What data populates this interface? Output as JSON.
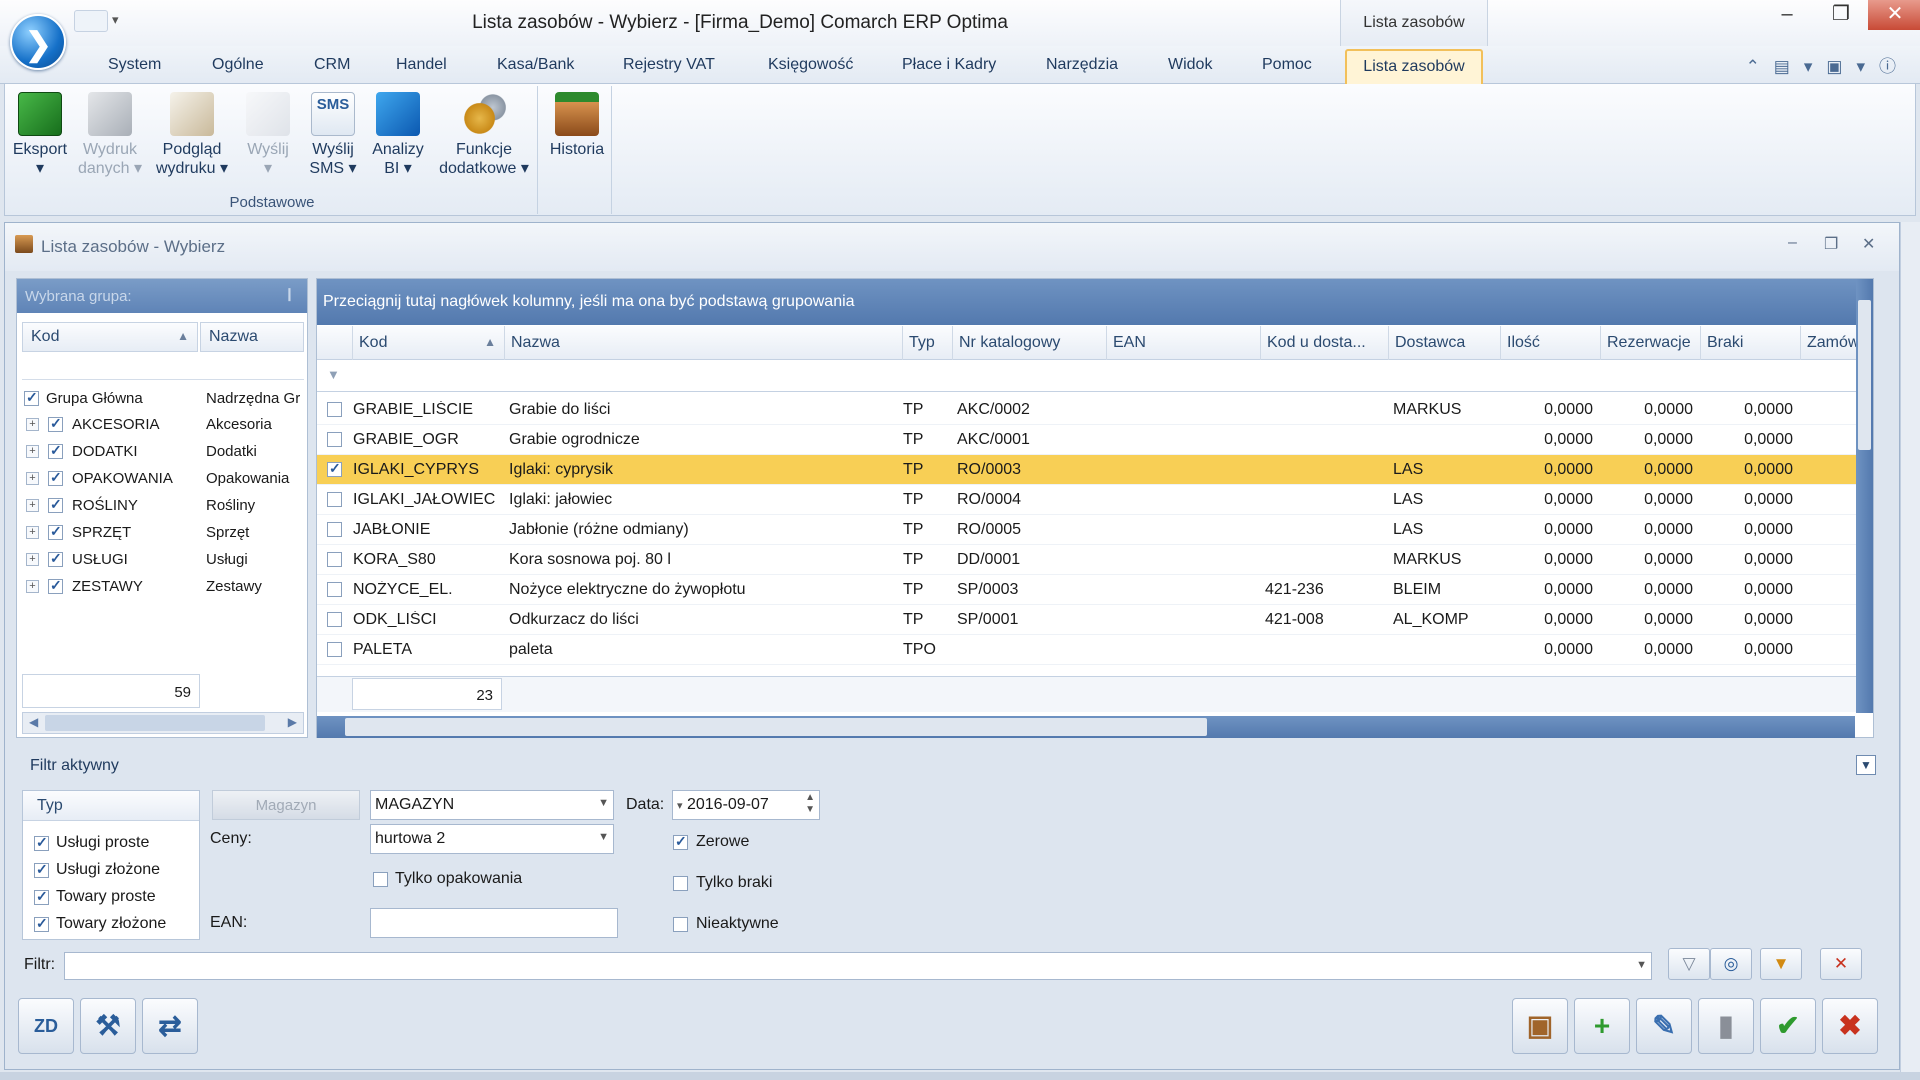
{
  "window": {
    "title": "Lista zasobów - Wybierz - [Firma_Demo] Comarch ERP Optima",
    "context_tab": "Lista zasobów",
    "min": "–",
    "restore": "❐",
    "close": "✕"
  },
  "menu": [
    "System",
    "Ogólne",
    "CRM",
    "Handel",
    "Kasa/Bank",
    "Rejestry VAT",
    "Księgowość",
    "Płace i Kadry",
    "Narzędzia",
    "Widok",
    "Pomoc"
  ],
  "menu_active": "Lista zasobów",
  "ribbon": {
    "buttons": [
      {
        "l1": "Eksport",
        "l2": "▾",
        "icon": "excel-export-icon"
      },
      {
        "l1": "Wydruk",
        "l2": "danych ▾",
        "icon": "printer-icon"
      },
      {
        "l1": "Podgląd",
        "l2": "wydruku ▾",
        "icon": "print-preview-icon"
      },
      {
        "l1": "Wyślij",
        "l2": "▾",
        "icon": "send-icon"
      },
      {
        "l1": "Wyślij",
        "l2": "SMS ▾",
        "icon": "sms-icon",
        "badge": "SMS"
      },
      {
        "l1": "Analizy",
        "l2": "BI ▾",
        "icon": "bi-analysis-icon"
      },
      {
        "l1": "Funkcje",
        "l2": "dodatkowe ▾",
        "icon": "gears-icon"
      }
    ],
    "history": "Historia",
    "group_label": "Podstawowe"
  },
  "inner_window": {
    "title": "Lista zasobów - Wybierz"
  },
  "left_panel": {
    "header": "Wybrana grupa:",
    "col_kod": "Kod",
    "col_nazwa": "Nazwa",
    "sort_arrow": "▲",
    "root": {
      "kod": "Grupa Główna",
      "nazwa": "Nadrzędna Gr"
    },
    "groups": [
      {
        "kod": "AKCESORIA",
        "nazwa": "Akcesoria"
      },
      {
        "kod": "DODATKI",
        "nazwa": "Dodatki"
      },
      {
        "kod": "OPAKOWANIA",
        "nazwa": "Opakowania"
      },
      {
        "kod": "ROŚLINY",
        "nazwa": "Rośliny"
      },
      {
        "kod": "SPRZĘT",
        "nazwa": "Sprzęt"
      },
      {
        "kod": "USŁUGI",
        "nazwa": "Usługi"
      },
      {
        "kod": "ZESTAWY",
        "nazwa": "Zestawy"
      }
    ],
    "count": "59"
  },
  "grid": {
    "group_hint": "Przeciągnij tutaj nagłówek kolumny, jeśli ma ona być podstawą grupowania",
    "columns": [
      "Kod",
      "Nazwa",
      "Typ",
      "Nr katalogowy",
      "EAN",
      "Kod u dosta...",
      "Dostawca",
      "Ilość",
      "Rezerwacje",
      "Braki",
      "Zamów"
    ],
    "sort_arrow": "▲",
    "rows": [
      {
        "kod": "GRABIE_LIŚCIE",
        "nazwa": "Grabie do liści",
        "typ": "TP",
        "nr": "AKC/0002",
        "ean": "",
        "kodd": "",
        "dost": "MARKUS",
        "ilosc": "0,0000",
        "rez": "0,0000",
        "braki": "0,0000",
        "selected": false
      },
      {
        "kod": "GRABIE_OGR",
        "nazwa": "Grabie ogrodnicze",
        "typ": "TP",
        "nr": "AKC/0001",
        "ean": "",
        "kodd": "",
        "dost": "",
        "ilosc": "0,0000",
        "rez": "0,0000",
        "braki": "0,0000",
        "selected": false
      },
      {
        "kod": "IGLAKI_CYPRYS",
        "nazwa": "Iglaki: cyprysik",
        "typ": "TP",
        "nr": "RO/0003",
        "ean": "",
        "kodd": "",
        "dost": "LAS",
        "ilosc": "0,0000",
        "rez": "0,0000",
        "braki": "0,0000",
        "selected": true
      },
      {
        "kod": "IGLAKI_JAŁOWIEC",
        "nazwa": "Iglaki: jałowiec",
        "typ": "TP",
        "nr": "RO/0004",
        "ean": "",
        "kodd": "",
        "dost": "LAS",
        "ilosc": "0,0000",
        "rez": "0,0000",
        "braki": "0,0000",
        "selected": false
      },
      {
        "kod": "JABŁONIE",
        "nazwa": "Jabłonie (różne odmiany)",
        "typ": "TP",
        "nr": "RO/0005",
        "ean": "",
        "kodd": "",
        "dost": "LAS",
        "ilosc": "0,0000",
        "rez": "0,0000",
        "braki": "0,0000",
        "selected": false
      },
      {
        "kod": "KORA_S80",
        "nazwa": "Kora sosnowa poj. 80 l",
        "typ": "TP",
        "nr": "DD/0001",
        "ean": "",
        "kodd": "",
        "dost": "MARKUS",
        "ilosc": "0,0000",
        "rez": "0,0000",
        "braki": "0,0000",
        "selected": false
      },
      {
        "kod": "NOŻYCE_EL.",
        "nazwa": "Nożyce elektryczne do żywopłotu",
        "typ": "TP",
        "nr": "SP/0003",
        "ean": "",
        "kodd": "421-236",
        "dost": "BLEIM",
        "ilosc": "0,0000",
        "rez": "0,0000",
        "braki": "0,0000",
        "selected": false
      },
      {
        "kod": "ODK_LIŚCI",
        "nazwa": "Odkurzacz do liści",
        "typ": "TP",
        "nr": "SP/0001",
        "ean": "",
        "kodd": "421-008",
        "dost": "AL_KOMP",
        "ilosc": "0,0000",
        "rez": "0,0000",
        "braki": "0,0000",
        "selected": false
      },
      {
        "kod": "PALETA",
        "nazwa": "paleta",
        "typ": "TPO",
        "nr": "",
        "ean": "",
        "kodd": "",
        "dost": "",
        "ilosc": "0,0000",
        "rez": "0,0000",
        "braki": "0,0000",
        "selected": false
      }
    ],
    "count": "23"
  },
  "filter": {
    "title": "Filtr aktywny",
    "typ_header": "Typ",
    "typ_items": [
      {
        "label": "Usługi proste",
        "checked": true
      },
      {
        "label": "Usługi złożone",
        "checked": true
      },
      {
        "label": "Towary proste",
        "checked": true
      },
      {
        "label": "Towary złożone",
        "checked": true
      }
    ],
    "magazyn_button": "Magazyn",
    "magazyn_value": "MAGAZYN",
    "ceny_label": "Ceny:",
    "ceny_value": "hurtowa 2",
    "ean_label": "EAN:",
    "ean_value": "",
    "tylko_opakowania": "Tylko opakowania",
    "data_label": "Data:",
    "data_value": "2016-09-07",
    "zerowe": "Zerowe",
    "tylko_braki": "Tylko braki",
    "nieaktywne": "Nieaktywne",
    "filtr_label": "Filtr:",
    "filtr_value": ""
  },
  "bottom_buttons_left": [
    {
      "icon": "zd-icon",
      "glyph": "ZD"
    },
    {
      "icon": "tools-icon",
      "glyph": "⚒"
    },
    {
      "icon": "transfer-icon",
      "glyph": "⇄"
    }
  ],
  "bottom_buttons_right": [
    {
      "icon": "package-icon",
      "glyph": "▣"
    },
    {
      "icon": "add-icon",
      "glyph": "+"
    },
    {
      "icon": "edit-icon",
      "glyph": "✎"
    },
    {
      "icon": "delete-icon",
      "glyph": "▮"
    },
    {
      "icon": "confirm-icon",
      "glyph": "✔"
    },
    {
      "icon": "cancel-icon",
      "glyph": "✖"
    }
  ],
  "colors": {
    "accent": "#5f84b7",
    "selected_row": "#f8cf55",
    "active_tab": "#f2c05a"
  }
}
